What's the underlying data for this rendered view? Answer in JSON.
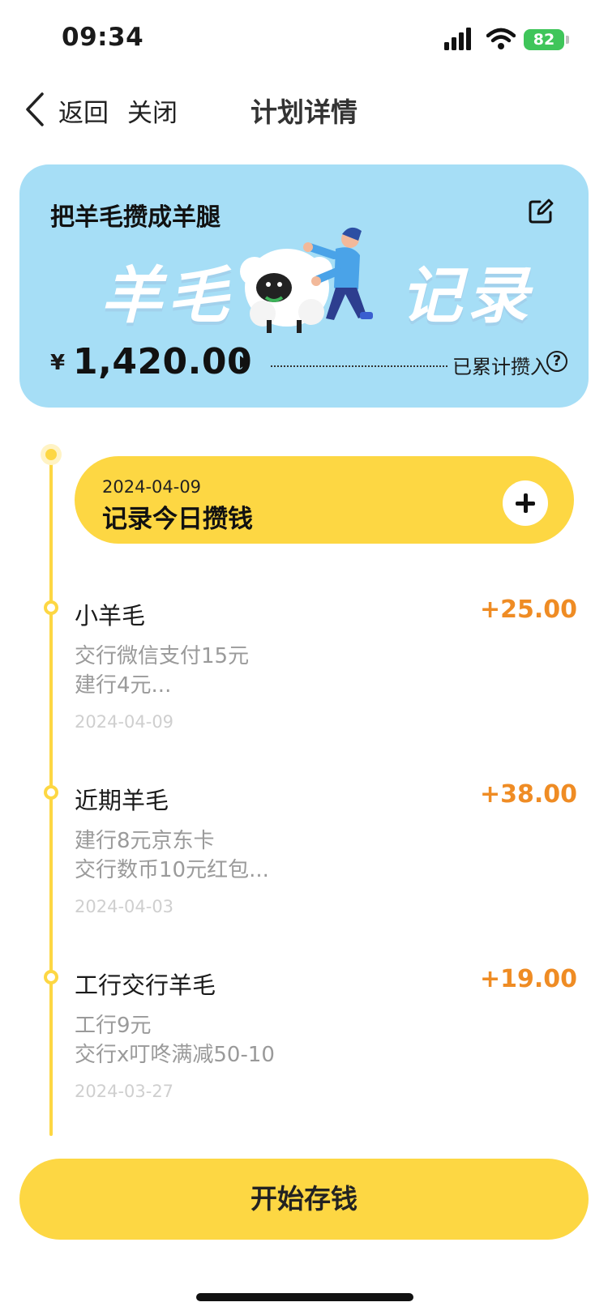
{
  "status_bar": {
    "time": "09:34",
    "battery": "82"
  },
  "nav": {
    "back": "返回",
    "close": "关闭",
    "title": "计划详情"
  },
  "plan": {
    "title": "把羊毛攒成羊腿",
    "banner_left": "羊毛",
    "banner_right": "记录",
    "currency": "¥",
    "amount": "1,420.00",
    "accum_label": "已累计攒入",
    "help_glyph": "?"
  },
  "today": {
    "date": "2024-04-09",
    "label": "记录今日攒钱"
  },
  "entries": [
    {
      "title": "小羊毛",
      "amount": "+25.00",
      "note1": "交行微信支付15元",
      "note2": "建行4元...",
      "date": "2024-04-09"
    },
    {
      "title": "近期羊毛",
      "amount": "+38.00",
      "note1": "建行8元京东卡",
      "note2": "交行数币10元红包...",
      "date": "2024-04-03"
    },
    {
      "title": "工行交行羊毛",
      "amount": "+19.00",
      "note1": "工行9元",
      "note2": "交行x叮咚满减50-10",
      "date": "2024-03-27"
    }
  ],
  "start_button": "开始存钱",
  "colors": {
    "card_blue": "#a6def6",
    "accent_yellow": "#fdd743",
    "amount_orange": "#ef8c24",
    "battery_green": "#3fc55a"
  },
  "icons": {
    "back": "chevron-left-icon",
    "edit": "edit-icon",
    "help": "question-circle-icon",
    "add": "plus-icon"
  }
}
